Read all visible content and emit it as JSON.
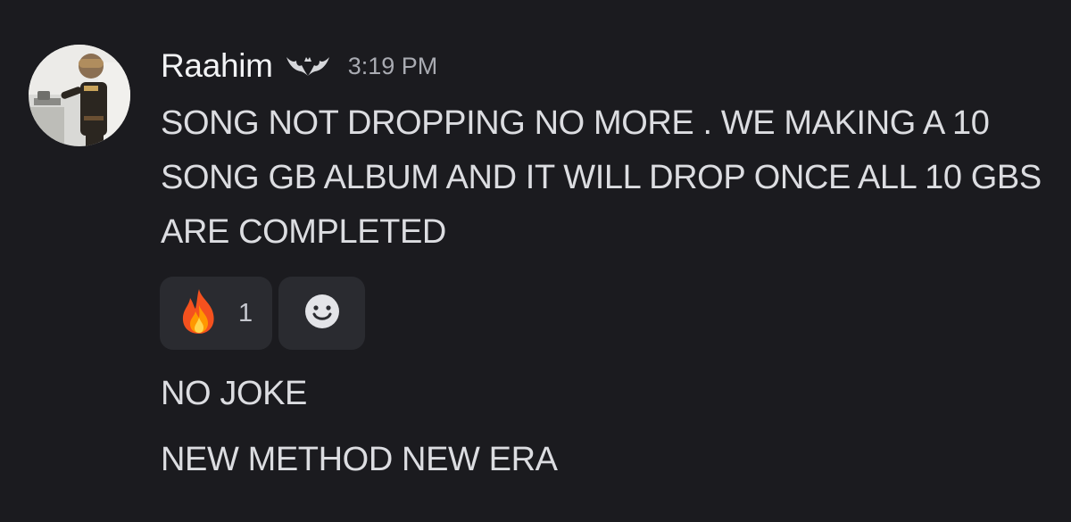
{
  "message": {
    "author": "Raahim",
    "author_badge_icon": "bat-icon",
    "timestamp": "3:19 PM",
    "text": "SONG NOT DROPPING NO MORE . WE MAKING A 10 SONG GB ALBUM AND IT WILL DROP ONCE ALL 10 GBS ARE COMPLETED",
    "reactions": [
      {
        "emoji": "🔥",
        "icon": "fire-emoji-icon",
        "count": "1"
      }
    ],
    "add_reaction_icon": "smiley-face-icon"
  },
  "followups": [
    {
      "text": "NO JOKE"
    },
    {
      "text": "NEW METHOD NEW ERA"
    }
  ],
  "colors": {
    "background": "#1b1b1f",
    "username": "#f2f3f5",
    "text": "#dcdde1",
    "timestamp": "#a9abb2",
    "reaction_bg": "#2a2b30"
  }
}
